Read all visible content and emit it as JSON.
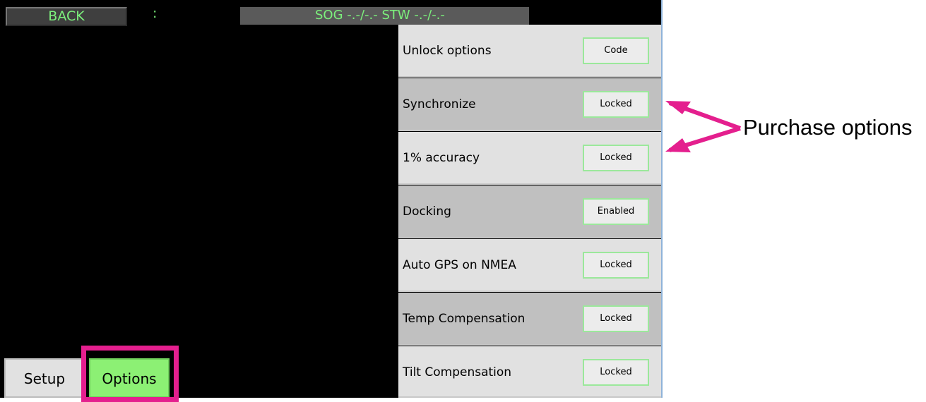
{
  "top_bar": {
    "back_label": "BACK",
    "colon_text": ":",
    "speed_text": "SOG -.-/-.- STW -.-/-.-"
  },
  "options": [
    {
      "label": "Unlock options",
      "button": "Code",
      "shade": "light"
    },
    {
      "label": "Synchronize",
      "button": "Locked",
      "shade": "dark"
    },
    {
      "label": "1% accuracy",
      "button": "Locked",
      "shade": "light"
    },
    {
      "label": "Docking",
      "button": "Enabled",
      "shade": "dark"
    },
    {
      "label": "Auto GPS on NMEA",
      "button": "Locked",
      "shade": "light"
    },
    {
      "label": "Temp Compensation",
      "button": "Locked",
      "shade": "dark"
    },
    {
      "label": "Tilt Compensation",
      "button": "Locked",
      "shade": "light"
    }
  ],
  "tabs": {
    "setup_label": "Setup",
    "options_label": "Options",
    "active": "Options"
  },
  "annotation": {
    "label": "Purchase options"
  },
  "colors": {
    "accent_text": "#7cf07c",
    "active_tab": "#8cf074",
    "highlight": "#e41f8e",
    "button_border": "#9be89b"
  }
}
